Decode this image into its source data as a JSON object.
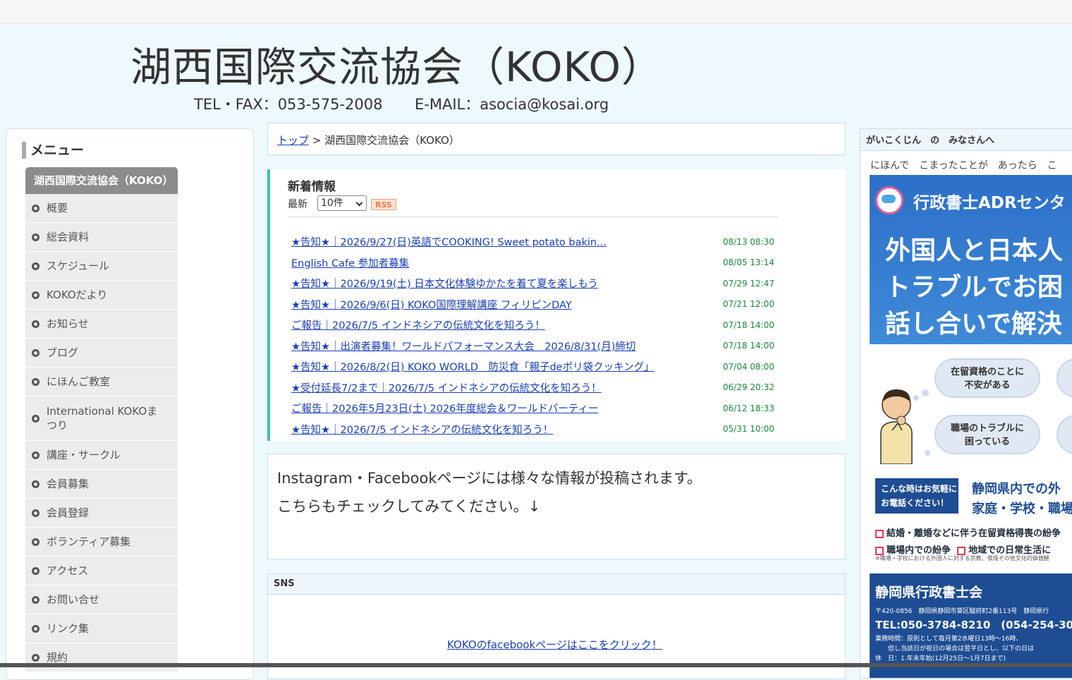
{
  "header": {
    "title": "湖西国際交流協会（KOKO）",
    "tel": "TEL・FAX：053-575-2008",
    "email": "E-MAIL：asocia@kosai.org"
  },
  "menu": {
    "heading": "メニュー",
    "active": "湖西国際交流協会（KOKO）",
    "items": [
      "概要",
      "総会資料",
      "スケジュール",
      "KOKOだより",
      "お知らせ",
      "ブログ",
      "にほんご教室",
      "International KOKOまつり",
      "講座・サークル",
      "会員募集",
      "会員登録",
      "ボランティア募集",
      "アクセス",
      "お問い合せ",
      "リンク集",
      "規約"
    ]
  },
  "breadcrumb": {
    "home": "トップ",
    "separator": " > ",
    "current": "湖西国際交流協会（KOKO）"
  },
  "news": {
    "title": "新着情報",
    "latest_label": "最新",
    "count_selected": "10件",
    "rss": "RSS",
    "items": [
      {
        "title": "★告知★｜2026/9/27(日)英語でCOOKING! Sweet potato bakin...",
        "date": "08/13 08:30"
      },
      {
        "title": "English Cafe 参加者募集",
        "date": "08/05 13:14"
      },
      {
        "title": "★告知★｜2026/9/19(土) 日本文化体験ゆかたを着て夏を楽しもう",
        "date": "07/29 12:47"
      },
      {
        "title": "★告知★｜2026/9/6(日) KOKO国際理解講座 フィリピンDAY",
        "date": "07/21 12:00"
      },
      {
        "title": "ご報告｜2026/7/5 インドネシアの伝統文化を知ろう！",
        "date": "07/18 14:00"
      },
      {
        "title": "★告知★｜出演者募集！ワールドパフォーマンス大会　2026/8/31(月)締切",
        "date": "07/18 14:00"
      },
      {
        "title": "★告知★｜2026/8/2(日) KOKO WORLD　防災食「親子deポリ袋クッキング」",
        "date": "07/04 08:00"
      },
      {
        "title": "★受付延長7/2まで｜2026/7/5 インドネシアの伝統文化を知ろう！",
        "date": "06/29 20:32"
      },
      {
        "title": "ご報告｜2026年5月23日(土) 2026年度総会＆ワールドパーティー",
        "date": "06/12 18:33"
      },
      {
        "title": "★告知★｜2026/7/5 インドネシアの伝統文化を知ろう！",
        "date": "05/31 10:00"
      }
    ]
  },
  "instagram": {
    "line1": "Instagram・Facebookページには様々な情報が投稿されます。",
    "line2": "こちらもチェックしてみてください。↓"
  },
  "sns": {
    "heading": "SNS",
    "facebook_link": "KOKOのfacebookページはここをクリック！"
  },
  "right": {
    "heading": "がいこくじん　の　みなさんへ",
    "text": "にほんで　こまったことが　あったら　こ",
    "banner": {
      "brand": "行政書士ADRセンタ",
      "line1": "外国人と日本人",
      "line2": "トラブルでお困",
      "line3": "話し合いで解決",
      "cloud1": "在留資格のことに\n不安がある",
      "cloud2": "職場のトラブルに\n困っている",
      "call": "こんな時はお気軽に\nお電話ください！",
      "blue1": "静岡県内での外",
      "blue2": "家庭・学校・職場",
      "check1": "結婚・離婚などに伴う在留資格得喪の紛争",
      "check2": "職場内での紛争",
      "check3": "地域での日常生活に",
      "fine": "※職場・学校における外国人に対する宗教、慣境その他文化的価値観",
      "assoc": "静岡県行政書士会",
      "address": "〒420-0856　静岡県静岡市葵区駿府町2番113号　静岡県行",
      "tel": "TEL:050-3784-8210　(054-254-30",
      "hours1": "業務時間：原則として毎月第2水曜日13時～16時、",
      "hours2": "　　但し当該日が祝日の場合は翌平日とし、以下の日は",
      "hours3": "休　日：1.年末年始(12月25日～1月7日まで)"
    }
  }
}
